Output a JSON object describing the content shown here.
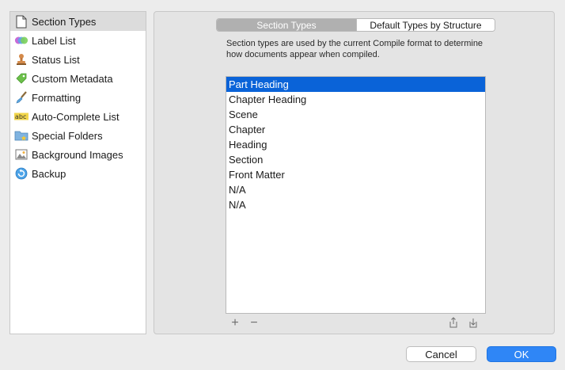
{
  "sidebar": {
    "items": [
      {
        "label": "Section Types",
        "icon": "document-icon",
        "selected": true
      },
      {
        "label": "Label List",
        "icon": "color-circles-icon",
        "selected": false
      },
      {
        "label": "Status List",
        "icon": "stamp-icon",
        "selected": false
      },
      {
        "label": "Custom Metadata",
        "icon": "tag-icon",
        "selected": false
      },
      {
        "label": "Formatting",
        "icon": "paintbrush-icon",
        "selected": false
      },
      {
        "label": "Auto-Complete List",
        "icon": "abc-icon",
        "selected": false
      },
      {
        "label": "Special Folders",
        "icon": "folder-star-icon",
        "selected": false
      },
      {
        "label": "Background Images",
        "icon": "image-icon",
        "selected": false
      },
      {
        "label": "Backup",
        "icon": "backup-icon",
        "selected": false
      }
    ]
  },
  "tabs": {
    "active": "Section Types",
    "other": "Default Types by Structure"
  },
  "description": "Section types are used by the current Compile format to determine how documents appear when compiled.",
  "section_types": [
    {
      "label": "Part Heading",
      "selected": true
    },
    {
      "label": "Chapter Heading",
      "selected": false
    },
    {
      "label": "Scene",
      "selected": false
    },
    {
      "label": "Chapter",
      "selected": false
    },
    {
      "label": "Heading",
      "selected": false
    },
    {
      "label": "Section",
      "selected": false
    },
    {
      "label": "Front Matter",
      "selected": false
    },
    {
      "label": "N/A",
      "selected": false
    },
    {
      "label": "N/A",
      "selected": false
    }
  ],
  "list_tools": {
    "add": "+",
    "remove": "−"
  },
  "buttons": {
    "cancel": "Cancel",
    "ok": "OK"
  },
  "colors": {
    "selection": "#0a63d8",
    "ok_button": "#2f86f6",
    "segment_active": "#b0b0b0"
  }
}
